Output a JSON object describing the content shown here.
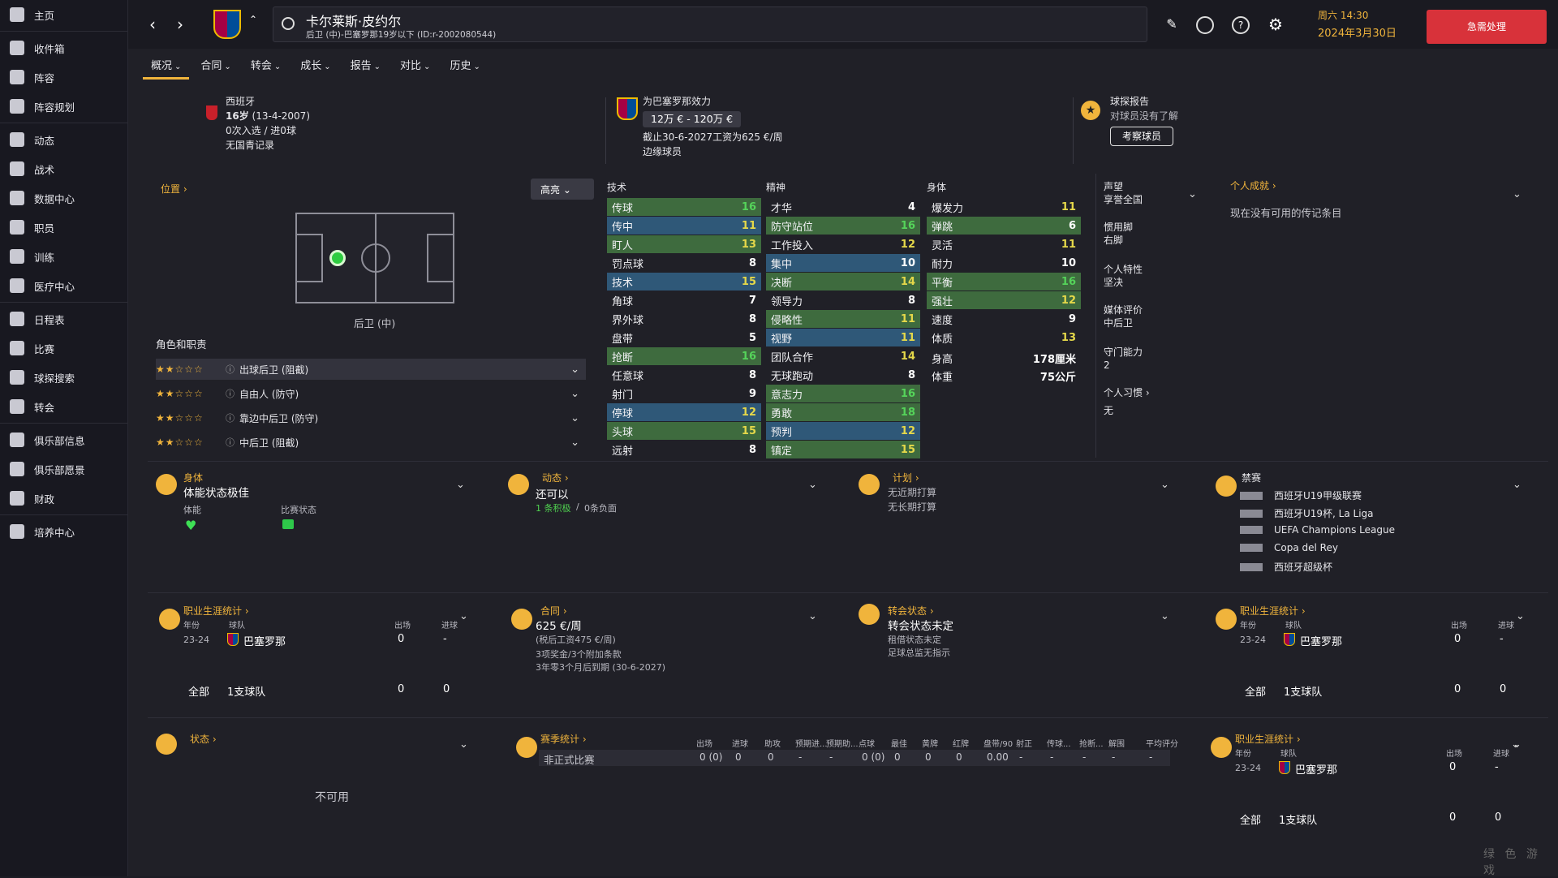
{
  "sidebar": {
    "items": [
      {
        "label": "主页"
      },
      {
        "label": "收件箱"
      },
      {
        "label": "阵容"
      },
      {
        "label": "阵容规划"
      },
      {
        "label": "动态"
      },
      {
        "label": "战术"
      },
      {
        "label": "数据中心"
      },
      {
        "label": "职员"
      },
      {
        "label": "训练"
      },
      {
        "label": "医疗中心"
      },
      {
        "label": "日程表"
      },
      {
        "label": "比赛"
      },
      {
        "label": "球探搜索"
      },
      {
        "label": "转会"
      },
      {
        "label": "俱乐部信息"
      },
      {
        "label": "俱乐部愿景"
      },
      {
        "label": "财政"
      },
      {
        "label": "培养中心"
      }
    ]
  },
  "topbar": {
    "player_name": "卡尔莱斯·皮约尔",
    "player_sub": "后卫 (中)-巴塞罗那19岁以下 (ID:r-2002080544)",
    "date_line1": "周六 14:30",
    "date_line2": "2024年3月30日",
    "urgent": "急需处理"
  },
  "tabs": [
    "概况",
    "合同",
    "转会",
    "成长",
    "报告",
    "对比",
    "历史"
  ],
  "header": {
    "nation": "西班牙",
    "age": "16岁",
    "dob": "(13-4-2007)",
    "caps": "0次入选 / 进0球",
    "youth": "无国青记录",
    "club_line": "为巴塞罗那效力",
    "value": "12万 € - 120万 €",
    "contract": "截止30-6-2027工资为625 €/周",
    "squad": "边缘球员",
    "scout_title": "球探报告",
    "scout_text": "对球员没有了解",
    "scout_btn": "考察球员"
  },
  "position": {
    "title": "位置",
    "highlight": "高亮",
    "pos_label": "后卫 (中)",
    "roles_title": "角色和职责",
    "roles": [
      {
        "stars": "★★☆☆☆",
        "name": "出球后卫 (阻截)"
      },
      {
        "stars": "★★☆☆☆",
        "name": "自由人 (防守)"
      },
      {
        "stars": "★★☆☆☆",
        "name": "靠边中后卫 (防守)"
      },
      {
        "stars": "★★☆☆☆",
        "name": "中后卫 (阻截)"
      }
    ]
  },
  "attributes": {
    "tech_title": "技术",
    "mental_title": "精神",
    "phys_title": "身体",
    "technical": [
      [
        "传球",
        "16"
      ],
      [
        "传中",
        "11"
      ],
      [
        "盯人",
        "13"
      ],
      [
        "罚点球",
        "8"
      ],
      [
        "技术",
        "15"
      ],
      [
        "角球",
        "7"
      ],
      [
        "界外球",
        "8"
      ],
      [
        "盘带",
        "5"
      ],
      [
        "抢断",
        "16"
      ],
      [
        "任意球",
        "8"
      ],
      [
        "射门",
        "9"
      ],
      [
        "停球",
        "12"
      ],
      [
        "头球",
        "15"
      ],
      [
        "远射",
        "8"
      ]
    ],
    "mental": [
      [
        "才华",
        "4"
      ],
      [
        "防守站位",
        "16"
      ],
      [
        "工作投入",
        "12"
      ],
      [
        "集中",
        "10"
      ],
      [
        "决断",
        "14"
      ],
      [
        "领导力",
        "8"
      ],
      [
        "侵略性",
        "11"
      ],
      [
        "视野",
        "11"
      ],
      [
        "团队合作",
        "14"
      ],
      [
        "无球跑动",
        "8"
      ],
      [
        "意志力",
        "16"
      ],
      [
        "勇敢",
        "18"
      ],
      [
        "预判",
        "12"
      ],
      [
        "镇定",
        "15"
      ]
    ],
    "physical": [
      [
        "爆发力",
        "11"
      ],
      [
        "弹跳",
        "6"
      ],
      [
        "灵活",
        "11"
      ],
      [
        "耐力",
        "10"
      ],
      [
        "平衡",
        "16"
      ],
      [
        "强壮",
        "12"
      ],
      [
        "速度",
        "9"
      ],
      [
        "体质",
        "13"
      ]
    ],
    "height_label": "身高",
    "height": "178厘米",
    "weight_label": "体重",
    "weight": "75公斤"
  },
  "info": {
    "rep_label": "声望",
    "rep": "享誉全国",
    "foot_label": "惯用脚",
    "foot": "右脚",
    "pers_label": "个人特性",
    "pers": "坚决",
    "media_label": "媒体评价",
    "media": "中后卫",
    "gk_label": "守门能力",
    "gk": "2",
    "habit_label": "个人习惯",
    "habit": "无",
    "achv_title": "个人成就",
    "achv_text": "现在没有可用的传记条目"
  },
  "cards": {
    "body_title": "身体",
    "body_val": "体能状态极佳",
    "stamina": "体能",
    "matchform": "比赛状态",
    "morale_title": "动态",
    "morale_val": "还可以",
    "morale_pos": "1 条积极",
    "morale_neg": "0条负面",
    "plan_title": "计划",
    "plan1": "无近期打算",
    "plan2": "无长期打算",
    "ban_title": "禁赛",
    "bans": [
      "西班牙U19甲级联赛",
      "西班牙U19杯, La Liga",
      "UEFA Champions League",
      "Copa del Rey",
      "西班牙超级杯"
    ],
    "career_title": "职业生涯统计",
    "year_h": "年份",
    "team_h": "球队",
    "apps_h": "出场",
    "goals_h": "进球",
    "year": "23-24",
    "team": "巴塞罗那",
    "apps": "0",
    "goals": "-",
    "total": "全部",
    "teams": "1支球队",
    "total_apps": "0",
    "total_goals": "0",
    "contract_title": "合同",
    "wage": "625 €/周",
    "wage_sub": "(税后工资475 €/周)",
    "clauses": "3项奖金/3个附加条款",
    "expiry": "3年零3个月后到期 (30-6-2027)",
    "transfer_title": "转会状态",
    "transfer_val": "转会状态未定",
    "loan": "租借状态未定",
    "director": "足球总监无指示",
    "status_title": "状态",
    "status_val": "不可用",
    "season_title": "赛季统计",
    "season_headers": [
      "出场",
      "进球",
      "助攻",
      "预期进...",
      "预期助...",
      "点球",
      "最佳",
      "黄牌",
      "红牌",
      "盘带/90",
      "射正",
      "传球...",
      "抢断...",
      "解围",
      "平均评分"
    ],
    "season_row": "非正式比赛",
    "season_vals": [
      "0 (0)",
      "0",
      "0",
      "-",
      "-",
      "0 (0)",
      "0",
      "0",
      "0",
      "0.00",
      "-",
      "-",
      "-",
      "-",
      "-"
    ]
  },
  "watermark": "绿 色 游 戏"
}
